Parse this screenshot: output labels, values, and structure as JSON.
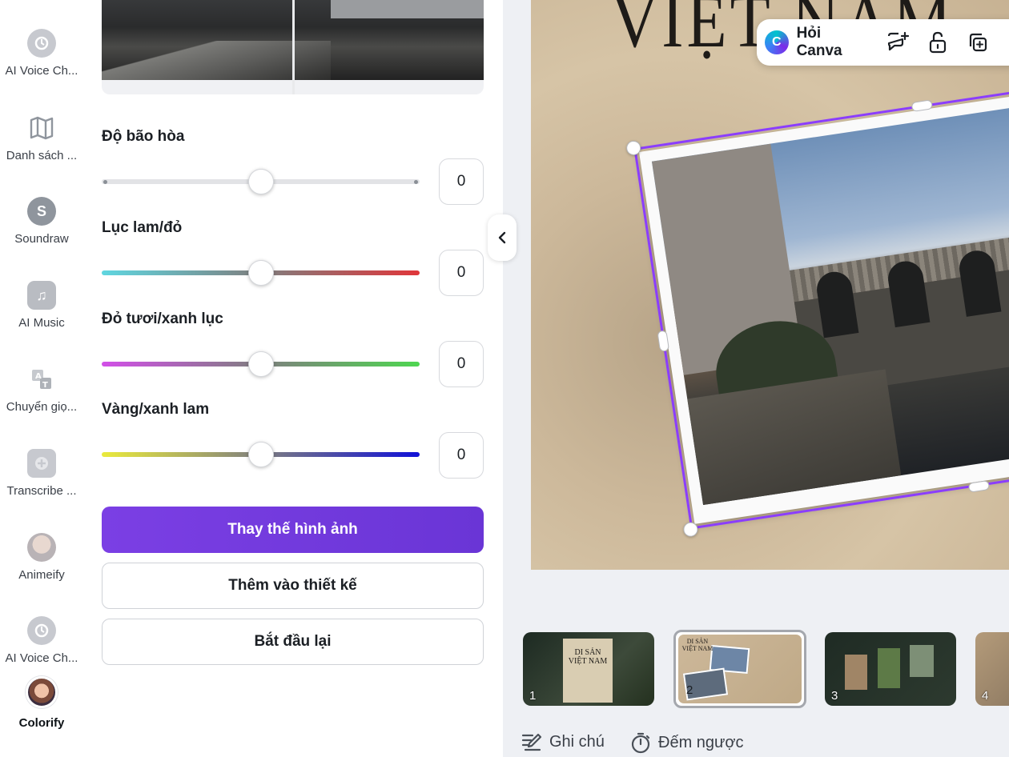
{
  "rail": {
    "items": [
      {
        "label": "AI Voice Ch...",
        "icon": "ai-voice-icon"
      },
      {
        "label": "Danh sách ...",
        "icon": "map-icon"
      },
      {
        "label": "Soundraw",
        "icon": "soundraw-icon"
      },
      {
        "label": "AI Music",
        "icon": "music-note-icon"
      },
      {
        "label": "Chuyển giọ...",
        "icon": "voice-convert-icon"
      },
      {
        "label": "Transcribe ...",
        "icon": "transcribe-icon"
      },
      {
        "label": "Animeify",
        "icon": "animeify-icon"
      },
      {
        "label": "AI Voice Ch...",
        "icon": "ai-voice-icon"
      },
      {
        "label": "Colorify",
        "icon": "colorify-icon"
      }
    ]
  },
  "panel": {
    "adjustments": [
      {
        "label": "Độ bão hòa",
        "value": "0",
        "level": 0.5,
        "gradient": [
          "#e2e3e6",
          "#e2e3e6"
        ]
      },
      {
        "label": "Lục lam/đỏ",
        "value": "0",
        "level": 0.5,
        "gradient": [
          "#5fd6e0",
          "#e0363a"
        ]
      },
      {
        "label": "Đỏ tươi/xanh lục",
        "value": "0",
        "level": 0.5,
        "gradient": [
          "#d24fe8",
          "#4ed650"
        ]
      },
      {
        "label": "Vàng/xanh lam",
        "value": "0",
        "level": 0.5,
        "gradient": [
          "#eaea3c",
          "#1010d8"
        ]
      }
    ],
    "buttons": {
      "replace": "Thay thế hình ảnh",
      "add_to_design": "Thêm vào thiết kế",
      "restart": "Bắt đầu lại"
    }
  },
  "canvas": {
    "page_title": "VIỆT NAM",
    "toolbar": {
      "ask_canva": "Hỏi Canva"
    }
  },
  "thumbnails": [
    {
      "num": "1",
      "title": "DI SẢN VIỆT NAM"
    },
    {
      "num": "2",
      "title": "DI SẢN VIỆT NAM"
    },
    {
      "num": "3",
      "title": ""
    },
    {
      "num": "4",
      "title": ""
    }
  ],
  "bottom": {
    "notes": "Ghi chú",
    "timer": "Đếm ngược"
  },
  "colors": {
    "accent": "#7d3ff0",
    "selection": "#8b3dff"
  }
}
